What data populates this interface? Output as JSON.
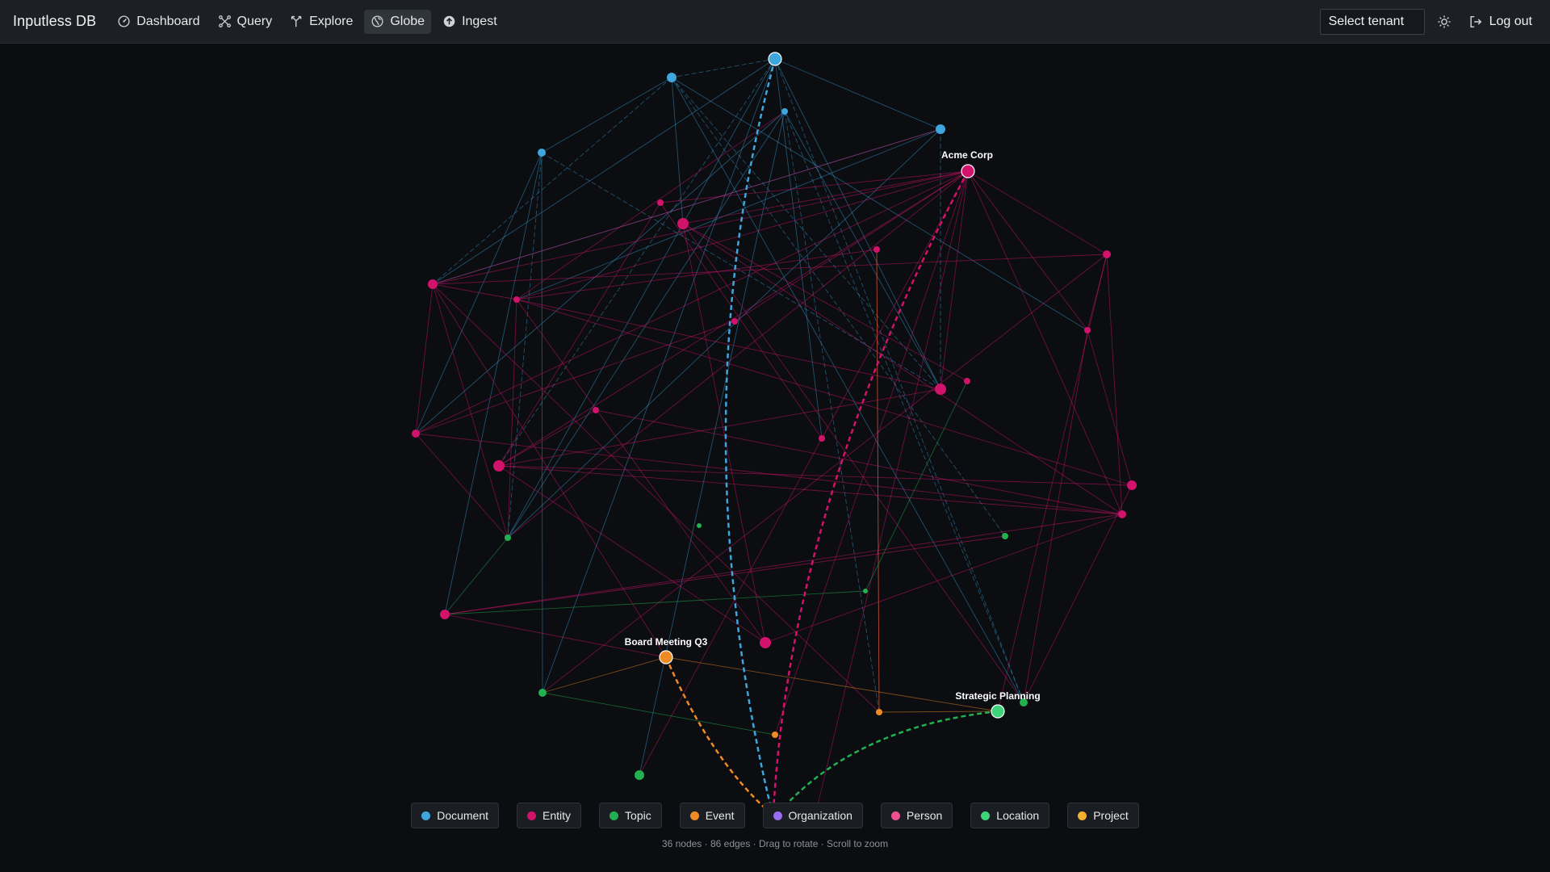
{
  "app": {
    "title": "Inputless DB"
  },
  "nav": [
    {
      "id": "dashboard",
      "label": "Dashboard",
      "icon": "dashboard-icon"
    },
    {
      "id": "query",
      "label": "Query",
      "icon": "query-icon"
    },
    {
      "id": "explore",
      "label": "Explore",
      "icon": "explore-icon"
    },
    {
      "id": "globe",
      "label": "Globe",
      "icon": "globe-icon",
      "active": true
    },
    {
      "id": "ingest",
      "label": "Ingest",
      "icon": "upload-icon"
    }
  ],
  "header": {
    "tenant_select": "Select tenant",
    "logout_label": "Log out",
    "theme_icon": "sun-icon"
  },
  "colors": {
    "document": "#3fa6dd",
    "entity": "#d1136b",
    "topic": "#22b050",
    "event": "#f08a24",
    "organization": "#9a6cf0",
    "person": "#ee4f8f",
    "location": "#3ed37a",
    "project": "#f2b02e"
  },
  "labels": {
    "acme": "Acme Corp",
    "board": "Board Meeting Q3",
    "strategic": "Strategic Planning"
  },
  "legend": [
    {
      "label": "Document",
      "type": "document"
    },
    {
      "label": "Entity",
      "type": "entity"
    },
    {
      "label": "Topic",
      "type": "topic"
    },
    {
      "label": "Event",
      "type": "event"
    },
    {
      "label": "Organization",
      "type": "organization"
    },
    {
      "label": "Person",
      "type": "person"
    },
    {
      "label": "Location",
      "type": "location"
    },
    {
      "label": "Project",
      "type": "project"
    }
  ],
  "stats": "36 nodes · 86 edges · Drag to rotate · Scroll to zoom"
}
